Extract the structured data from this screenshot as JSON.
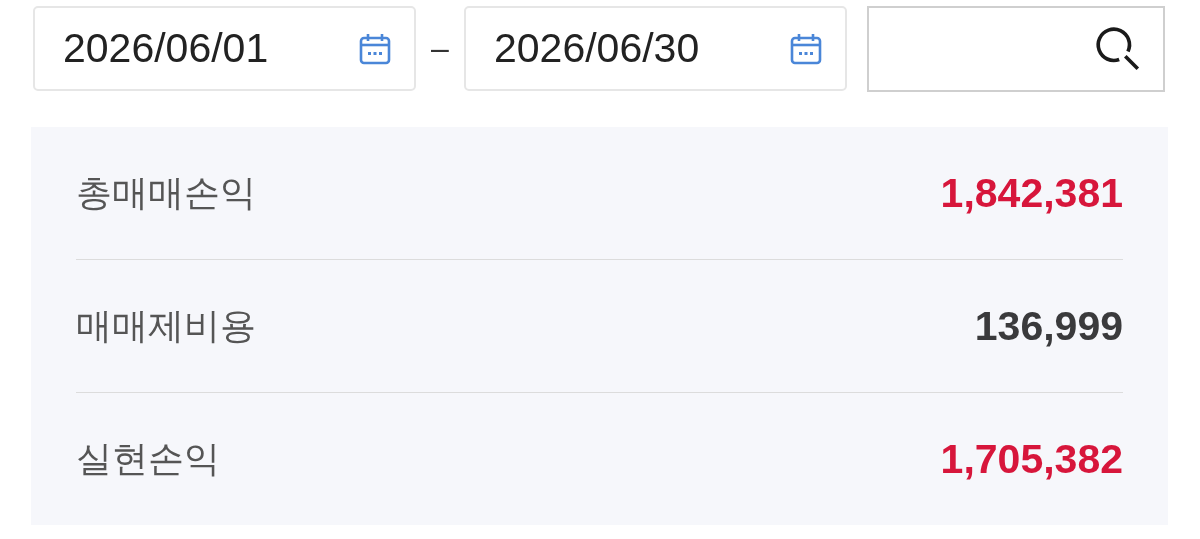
{
  "date_range": {
    "start": "2026/06/01",
    "separator": "–",
    "end": "2026/06/30"
  },
  "summary": [
    {
      "label": "총매매손익",
      "value": "1,842,381",
      "color": "#d7163b"
    },
    {
      "label": "매매제비용",
      "value": "136,999",
      "color": "#3a3a3c"
    },
    {
      "label": "실현손익",
      "value": "1,705,382",
      "color": "#d7163b"
    }
  ]
}
